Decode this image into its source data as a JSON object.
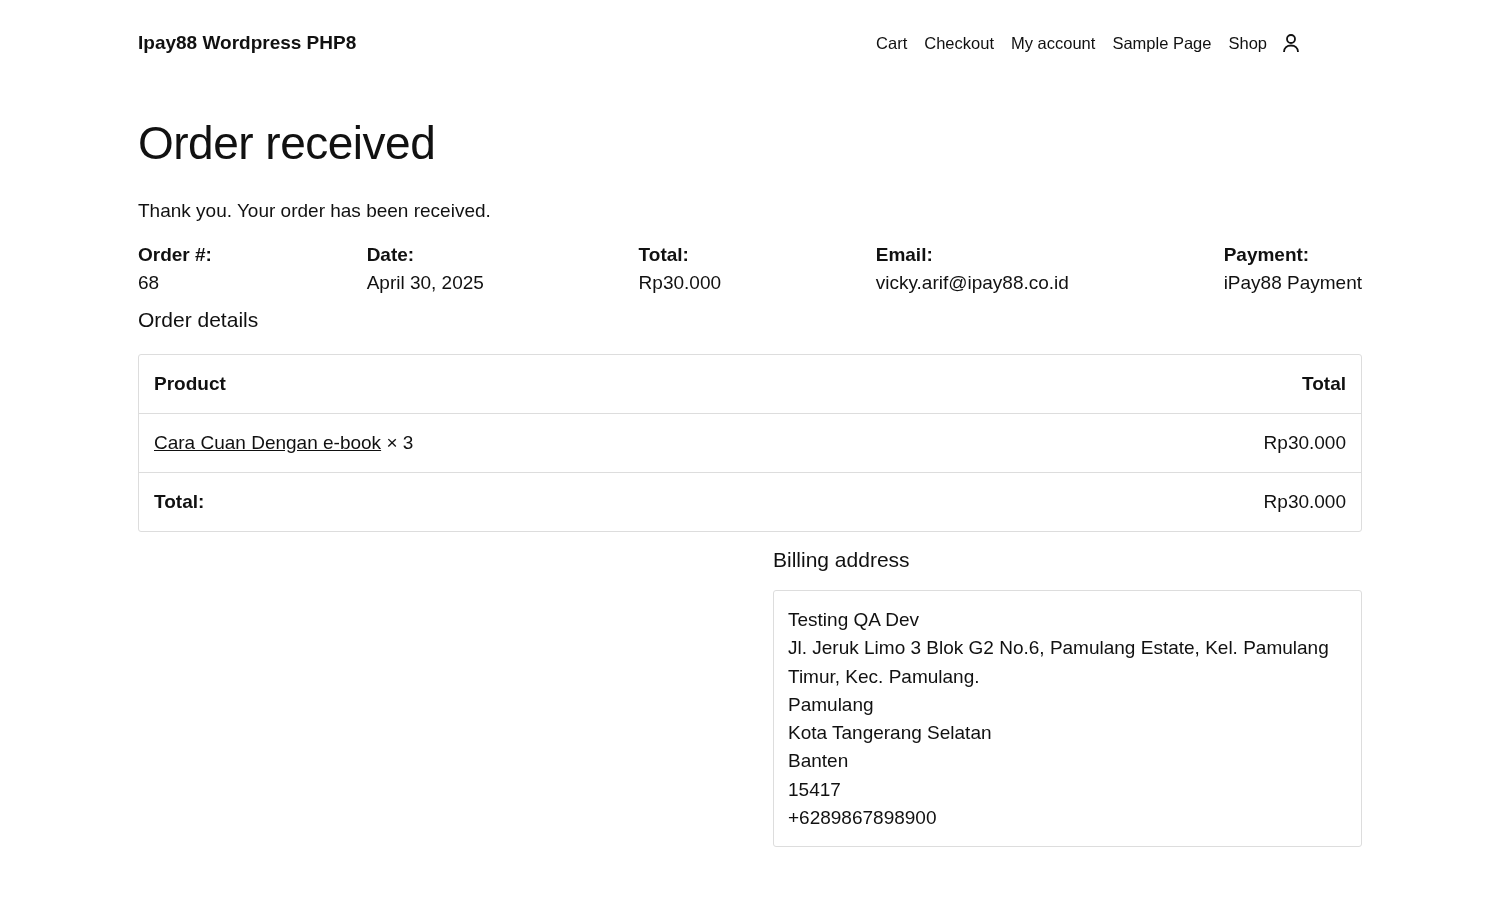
{
  "site": {
    "title": "Ipay88 Wordpress PHP8"
  },
  "nav": [
    {
      "label": "Cart"
    },
    {
      "label": "Checkout"
    },
    {
      "label": "My account"
    },
    {
      "label": "Sample Page"
    },
    {
      "label": "Shop"
    }
  ],
  "page_title": "Order received",
  "notice": "Thank you. Your order has been received.",
  "overview": [
    {
      "label": "Order #:",
      "value": "68"
    },
    {
      "label": "Date:",
      "value": "April 30, 2025"
    },
    {
      "label": "Total:",
      "value": "Rp30.000"
    },
    {
      "label": "Email:",
      "value": "vicky.arif@ipay88.co.id"
    },
    {
      "label": "Payment:",
      "value": "iPay88 Payment"
    }
  ],
  "details_heading": "Order details",
  "table": {
    "columns": [
      "Product",
      "Total"
    ],
    "rows": [
      {
        "product": "Cara Cuan Dengan e-book",
        "quantity": "× 3",
        "total": "Rp30.000"
      }
    ],
    "footer": {
      "label": "Total:",
      "value": "Rp30.000"
    }
  },
  "billing": {
    "heading": "Billing address",
    "lines": [
      "Testing QA Dev",
      "Jl. Jeruk Limo 3 Blok G2 No.6, Pamulang Estate, Kel. Pamulang Timur, Kec. Pamulang.",
      "Pamulang",
      "Kota Tangerang Selatan",
      "Banten",
      "15417",
      "+6289867898900"
    ]
  }
}
